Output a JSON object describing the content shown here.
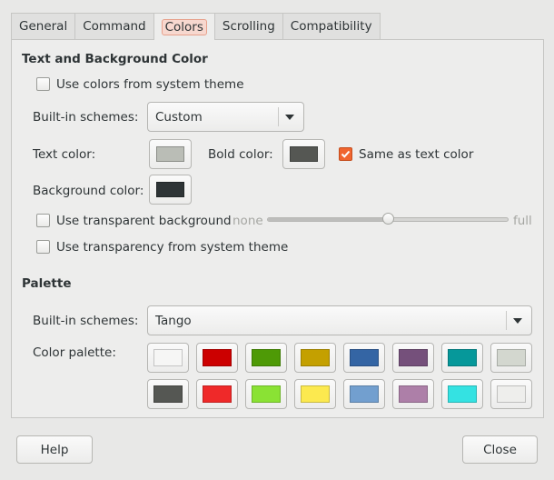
{
  "tabs": [
    {
      "label": "General"
    },
    {
      "label": "Command"
    },
    {
      "label": "Colors"
    },
    {
      "label": "Scrolling"
    },
    {
      "label": "Compatibility"
    }
  ],
  "text_bg_section": {
    "title": "Text and Background Color",
    "use_system_colors_label": "Use colors from system theme",
    "use_system_colors_checked": false,
    "builtin_label": "Built-in schemes:",
    "builtin_value": "Custom",
    "text_color_label": "Text color:",
    "text_color": "#babdb6",
    "bold_color_label": "Bold color:",
    "bold_color": "#555753",
    "same_as_text_label": "Same as text color",
    "same_as_text_checked": true,
    "background_color_label": "Background color:",
    "background_color": "#2e3436",
    "transparent_bg_label": "Use transparent background",
    "transparent_bg_checked": false,
    "slider_min_label": "none",
    "slider_max_label": "full",
    "slider_value": 0.5,
    "transparency_system_label": "Use transparency from system theme",
    "transparency_system_checked": false
  },
  "palette_section": {
    "title": "Palette",
    "builtin_label": "Built-in schemes:",
    "builtin_value": "Tango",
    "color_palette_label": "Color palette:",
    "colors": [
      "#f6f6f5",
      "#cc0000",
      "#4e9a06",
      "#c4a000",
      "#3465a4",
      "#75507b",
      "#06989a",
      "#d3d7cf",
      "#555753",
      "#ef2929",
      "#8ae234",
      "#fce94f",
      "#729fcf",
      "#ad7fa8",
      "#34e2e2",
      "#eeeeec"
    ]
  },
  "buttons": {
    "help": "Help",
    "close": "Close"
  }
}
